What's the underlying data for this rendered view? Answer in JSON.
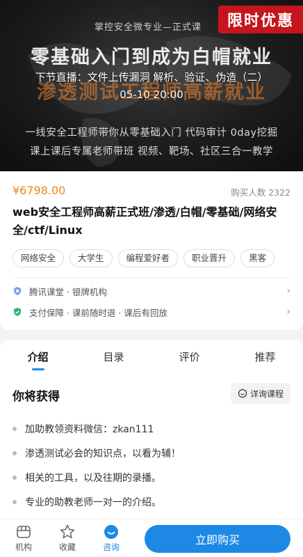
{
  "banner": {
    "top_caption": "掌控安全微专业—正式课",
    "promo": "限时优惠",
    "headline": "零基础入门到成为白帽就业",
    "headline2": "渗透测试工程师高薪就业",
    "live_title": "下节直播：文件上传漏洞 解析、验证、伪造（二）",
    "live_time": "05-10 20:00",
    "sub_line1": "一线安全工程师带你从零基础入门 代码审计 0day挖掘",
    "sub_line2": "课上课后专属老师带班  视频、靶场、社区三合一教学"
  },
  "course": {
    "price": "¥6798.00",
    "buyers": "购买人数 2322",
    "title": "web安全工程师高薪正式班/渗透/白帽/零基础/网络安全/ctf/Linux",
    "tags": [
      "网络安全",
      "大学生",
      "编程爱好者",
      "职业晋升",
      "黑客"
    ],
    "org": "腾讯课堂 · 银牌机构",
    "guarantee": "支付保障 · 课前随时退 · 课后有回放"
  },
  "tabs": [
    "介绍",
    "目录",
    "评价",
    "推荐"
  ],
  "gain": {
    "title": "你将获得",
    "consult": "详询课程",
    "items": [
      "加助教领资料微信：zkan111",
      "渗透测试必会的知识点，以看为辅！",
      "相关的工具，以及往期的录播。",
      "专业的助教老师一对一的介绍。"
    ]
  },
  "bottom": {
    "org": "机构",
    "fav": "收藏",
    "consult": "咨询",
    "buy": "立即购买"
  },
  "colors": {
    "accent": "#1e88e5",
    "price": "#f0851a",
    "promo": "#c4161c"
  }
}
